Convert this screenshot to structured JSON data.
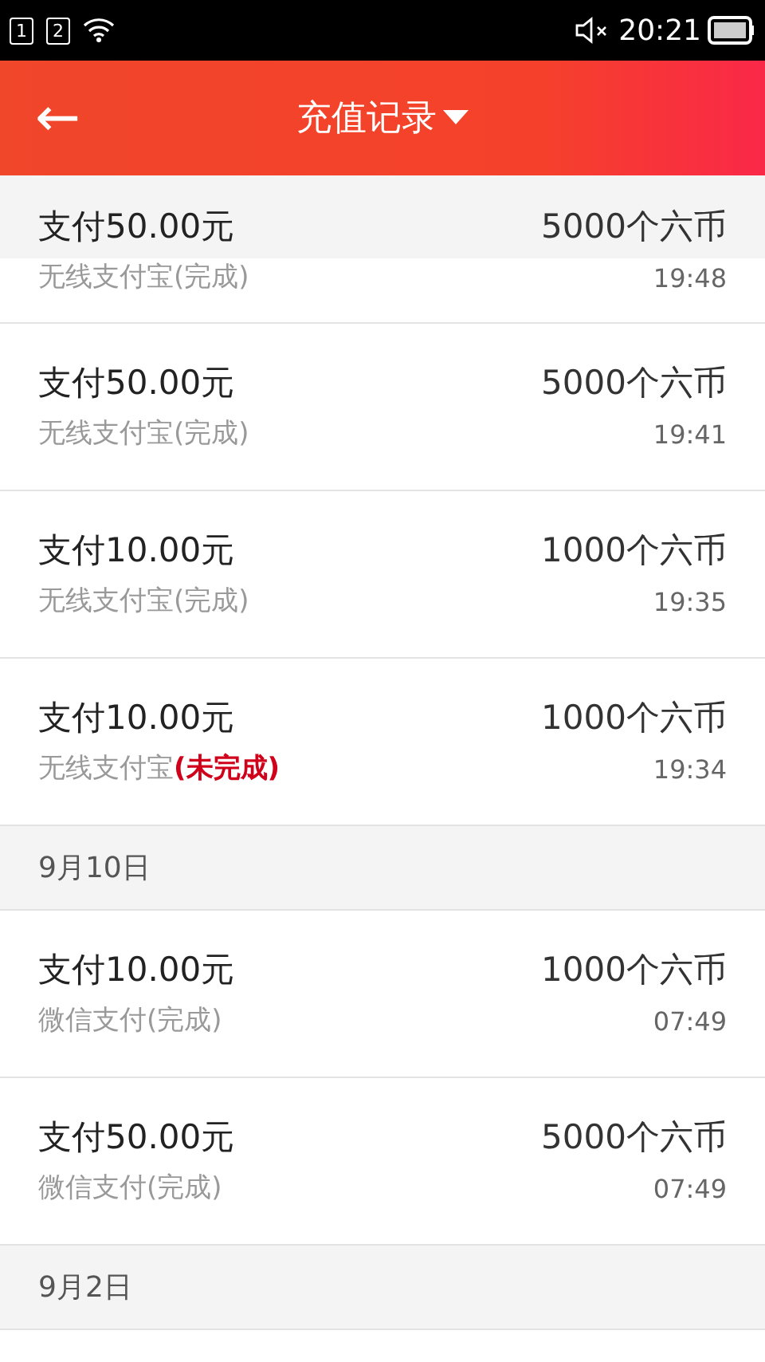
{
  "status_bar": {
    "sim_1": "1",
    "sim_2": "2",
    "time": "20:21"
  },
  "header": {
    "title": "充值记录",
    "back_icon": "←"
  },
  "sections": [
    {
      "partial": true,
      "records": [
        {
          "title": "支付50.00元",
          "method": "无线支付宝",
          "status": "(完成)",
          "completed": true,
          "amount": "5000个六币",
          "time": "19:48"
        },
        {
          "title": "支付50.00元",
          "method": "无线支付宝",
          "status": "(完成)",
          "completed": true,
          "amount": "5000个六币",
          "time": "19:41"
        },
        {
          "title": "支付10.00元",
          "method": "无线支付宝",
          "status": "(完成)",
          "completed": true,
          "amount": "1000个六币",
          "time": "19:35"
        },
        {
          "title": "支付10.00元",
          "method": "无线支付宝",
          "status": "(未完成)",
          "completed": false,
          "amount": "1000个六币",
          "time": "19:34"
        }
      ]
    },
    {
      "date": "9月10日",
      "records": [
        {
          "title": "支付10.00元",
          "method": "微信支付",
          "status": "(完成)",
          "completed": true,
          "amount": "1000个六币",
          "time": "07:49"
        },
        {
          "title": "支付50.00元",
          "method": "微信支付",
          "status": "(完成)",
          "completed": true,
          "amount": "5000个六币",
          "time": "07:49"
        }
      ]
    },
    {
      "date": "9月2日"
    }
  ]
}
